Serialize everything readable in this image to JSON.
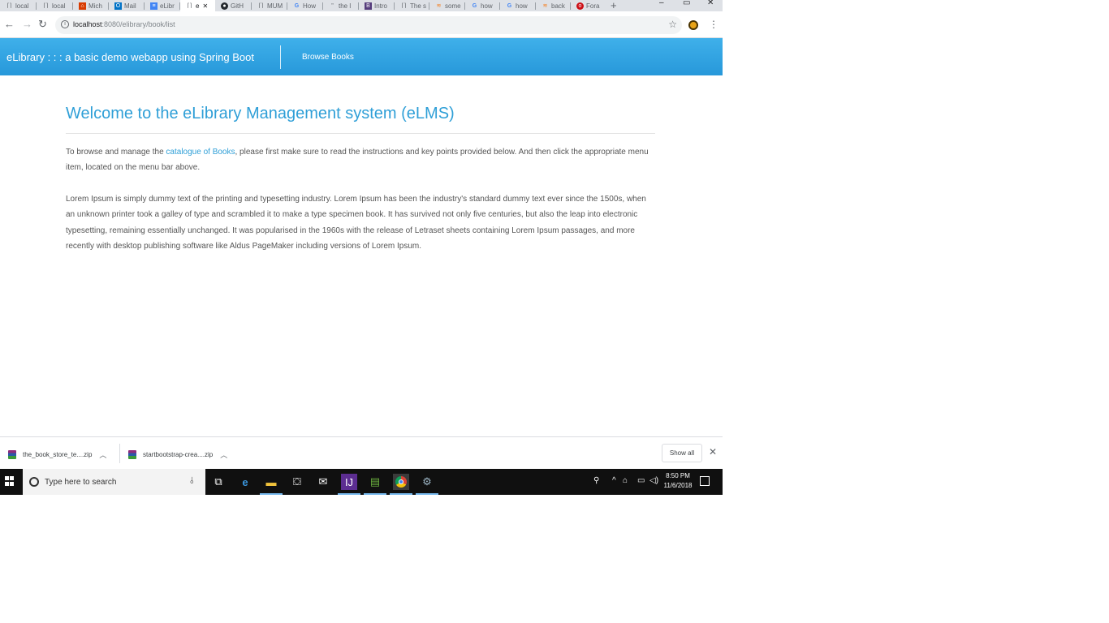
{
  "tabs": [
    {
      "label": "local",
      "icon": "page-icon"
    },
    {
      "label": "local",
      "icon": "page-icon"
    },
    {
      "label": "Mich",
      "icon": "office-icon"
    },
    {
      "label": "Mail",
      "icon": "outlook-icon"
    },
    {
      "label": "eLibr",
      "icon": "docs-icon"
    },
    {
      "label": "e",
      "icon": "page-icon",
      "active": true
    },
    {
      "label": "GitH",
      "icon": "github-icon"
    },
    {
      "label": "MUM",
      "icon": "page-icon"
    },
    {
      "label": "How",
      "icon": "google-icon"
    },
    {
      "label": "the l",
      "icon": "page-icon"
    },
    {
      "label": "Intro",
      "icon": "bootstrap-icon"
    },
    {
      "label": "The s",
      "icon": "page-icon"
    },
    {
      "label": "some",
      "icon": "stackoverflow-icon"
    },
    {
      "label": "how",
      "icon": "google-icon"
    },
    {
      "label": "how",
      "icon": "google-icon"
    },
    {
      "label": "back",
      "icon": "stackoverflow-icon"
    },
    {
      "label": "Fora",
      "icon": "opera-icon"
    }
  ],
  "address_bar": {
    "url_host": "localhost",
    "url_rest": ":8080/elibrary/book/list"
  },
  "app": {
    "brand": "eLibrary : : : a basic demo webapp using Spring Boot",
    "nav_browse": "Browse Books"
  },
  "content": {
    "title": "Welcome to the eLibrary Management system (eLMS)",
    "para1_before": "To browse and manage the ",
    "para1_link": "catalogue of Books",
    "para1_after": ", please first make sure to read the instructions and key points provided below. And then click the appropriate menu item, located on the menu bar above.",
    "para2": "Lorem Ipsum is simply dummy text of the printing and typesetting industry. Lorem Ipsum has been the industry's standard dummy text ever since the 1500s, when an unknown printer took a galley of type and scrambled it to make a type specimen book. It has survived not only five centuries, but also the leap into electronic typesetting, remaining essentially unchanged. It was popularised in the 1960s with the release of Letraset sheets containing Lorem Ipsum passages, and more recently with desktop publishing software like Aldus PageMaker including versions of Lorem Ipsum."
  },
  "downloads": {
    "item1": "the_book_store_te....zip",
    "item2": "startbootstrap-crea....zip",
    "show_all": "Show all"
  },
  "taskbar": {
    "search_placeholder": "Type here to search",
    "time": "8:50 PM",
    "date": "11/6/2018"
  },
  "colors": {
    "navbar": "#2fa4e7",
    "title": "#2f9fd7",
    "link": "#2f9fd7"
  }
}
